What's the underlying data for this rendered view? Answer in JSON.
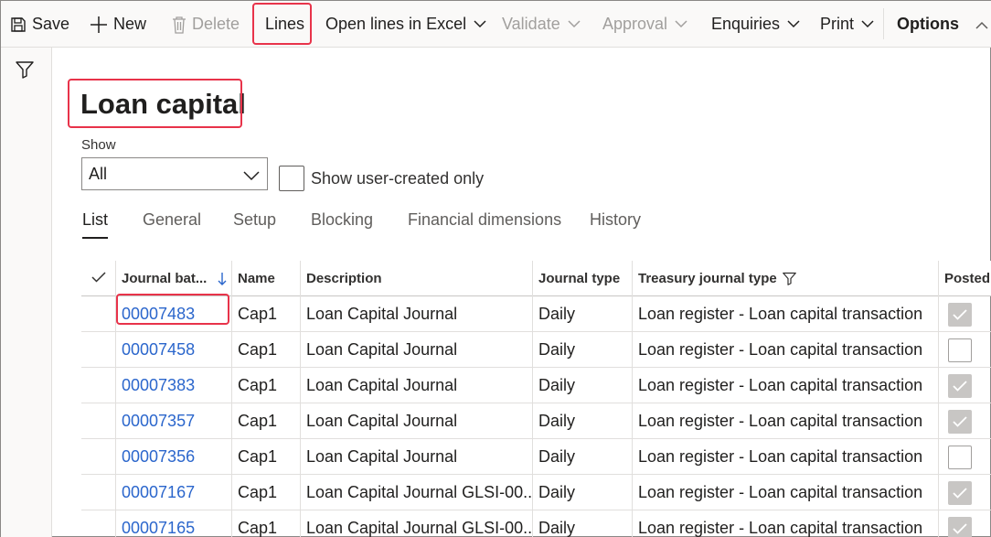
{
  "toolbar": {
    "save_label": "Save",
    "new_label": "New",
    "delete_label": "Delete",
    "lines_label": "Lines",
    "open_in_excel_label": "Open lines in Excel",
    "validate_label": "Validate",
    "approval_label": "Approval",
    "enquiries_label": "Enquiries",
    "print_label": "Print",
    "options_label": "Options"
  },
  "page": {
    "title": "Loan capital"
  },
  "filters": {
    "show_label": "Show",
    "show_value": "All",
    "user_created_label": "Show user-created only",
    "user_created_checked": false
  },
  "tabs": [
    {
      "label": "List",
      "active": true
    },
    {
      "label": "General",
      "active": false
    },
    {
      "label": "Setup",
      "active": false
    },
    {
      "label": "Blocking",
      "active": false
    },
    {
      "label": "Financial dimensions",
      "active": false
    },
    {
      "label": "History",
      "active": false
    }
  ],
  "grid": {
    "columns": {
      "journal_batch": "Journal bat...",
      "name": "Name",
      "description": "Description",
      "journal_type": "Journal type",
      "treasury_journal_type": "Treasury journal type",
      "posted": "Posted"
    },
    "sort_direction": "descending",
    "rows": [
      {
        "journal_batch": "00007483",
        "name": "Cap1",
        "description": "Loan Capital Journal",
        "journal_type": "Daily",
        "treasury_journal_type": "Loan register - Loan capital transaction",
        "posted": true
      },
      {
        "journal_batch": "00007458",
        "name": "Cap1",
        "description": "Loan Capital Journal",
        "journal_type": "Daily",
        "treasury_journal_type": "Loan register - Loan capital transaction",
        "posted": false
      },
      {
        "journal_batch": "00007383",
        "name": "Cap1",
        "description": "Loan Capital Journal",
        "journal_type": "Daily",
        "treasury_journal_type": "Loan register - Loan capital transaction",
        "posted": true
      },
      {
        "journal_batch": "00007357",
        "name": "Cap1",
        "description": "Loan Capital Journal",
        "journal_type": "Daily",
        "treasury_journal_type": "Loan register - Loan capital transaction",
        "posted": true
      },
      {
        "journal_batch": "00007356",
        "name": "Cap1",
        "description": "Loan Capital Journal",
        "journal_type": "Daily",
        "treasury_journal_type": "Loan register - Loan capital transaction",
        "posted": false
      },
      {
        "journal_batch": "00007167",
        "name": "Cap1",
        "description": "Loan Capital Journal GLSI-00...",
        "journal_type": "Daily",
        "treasury_journal_type": "Loan register - Loan capital transaction",
        "posted": true
      },
      {
        "journal_batch": "00007165",
        "name": "Cap1",
        "description": "Loan Capital Journal GLSI-00...",
        "journal_type": "Daily",
        "treasury_journal_type": "Loan register - Loan capital transaction",
        "posted": true
      }
    ]
  },
  "colors": {
    "link": "#2b66cc",
    "highlight": "#e8334a",
    "posted_checked_bg": "#c8c6c4"
  },
  "icons": {
    "save": "save-icon",
    "new": "plus-icon",
    "delete": "trash-icon",
    "filter": "filter-icon",
    "sort": "arrow-down-icon",
    "chevron": "chevron-down-icon",
    "check": "checkmark-icon"
  }
}
